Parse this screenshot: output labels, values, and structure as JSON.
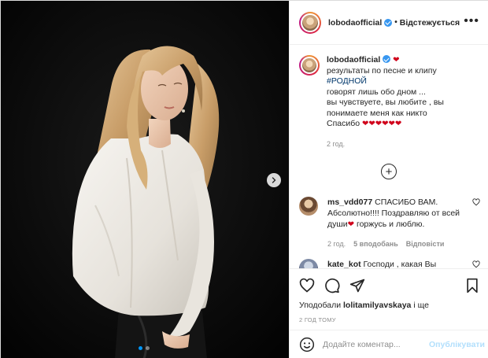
{
  "post": {
    "username": "lobodaofficial",
    "follow_status": "Відстежується",
    "separator": "•",
    "more_glyph": "•••"
  },
  "caption": {
    "username": "lobodaofficial",
    "line1_suffix": "❤",
    "line1": "результаты по песне и клипу",
    "hashtag": "#РОДНОЙ",
    "line2": "говорят лишь обо дном ...",
    "line3": "вы чувствуете, вы любите , вы",
    "line4": "понимаете меня как никто",
    "line5": "Спасибо",
    "hearts": "❤❤❤❤❤❤",
    "time": "2 год."
  },
  "comments": [
    {
      "username": "ms_vdd077",
      "text_a": "СПАСИБО ВАМ. Абсолютно!!!! Поздравляю от всей души",
      "heart": "❤",
      "text_b": "горжусь и люблю.",
      "time": "2 год.",
      "likes": "5 вподобань",
      "reply": "Відповісти"
    },
    {
      "username": "kate_kot",
      "text_a": "Господи , какая Вы"
    }
  ],
  "actions": {
    "liked_by_prefix": "Уподобали",
    "liked_by_user": "lolitamilyavskaya",
    "liked_by_suffix": "і ще",
    "time_ago": "2 год тому"
  },
  "add_comment": {
    "placeholder": "Додайте коментар...",
    "publish_label": "Опублікувати"
  },
  "colors": {
    "verified": "#3897f0",
    "heart": "#d0021b",
    "publish_disabled": "#b2dffc",
    "hashtag": "#00376b"
  },
  "icons": {
    "next": "chevron-right-icon",
    "load_more": "plus-circle-icon",
    "like": "heart-outline-icon",
    "comment": "comment-icon",
    "share": "paper-plane-icon",
    "save": "bookmark-icon",
    "emoji": "smiley-icon"
  },
  "media": {
    "slides_total": 2,
    "active_slide": 1
  }
}
